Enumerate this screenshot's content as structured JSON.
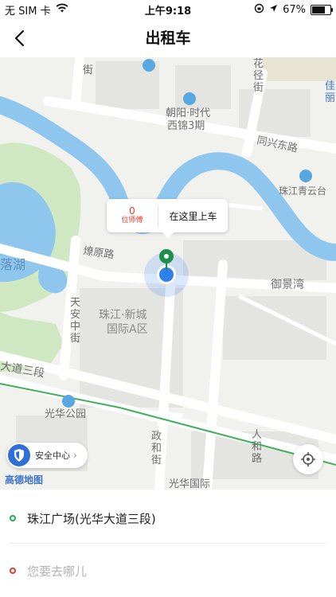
{
  "status_bar": {
    "carrier": "无 SIM 卡",
    "time": "上午9:18",
    "battery_percent": "67%",
    "battery_level": 0.67
  },
  "header": {
    "title": "出租车"
  },
  "map": {
    "labels": {
      "jie": "街",
      "huaxiang_jie": "花\n径\n街",
      "zhaoyang_1": "朝阳·时代",
      "zhaoyang_2": "西锦3期",
      "tongxing": "同兴东路",
      "zhujiang_qingyun": "珠江青云台",
      "jia_li": "佳\n丽",
      "luohu": "落湖",
      "liaoyuan": "燎原路",
      "yujingwan": "御景湾",
      "tianan": "天\n安\n中\n街",
      "xincheng_1": "珠江·新城",
      "xincheng_2": "国际A区",
      "dadao": "大道三段",
      "guanghua_park": "光华公园",
      "zhenghe": "政\n和\n街",
      "renhe": "人\n和\n路",
      "guanghua_intl": "光华国际"
    }
  },
  "pickup_bubble": {
    "count": "0",
    "count_label": "位师傅",
    "action": "在这里上车"
  },
  "safety_center": {
    "label": "安全中心",
    "chevron": "›"
  },
  "map_brand": "高德地图",
  "trip": {
    "start": "珠江广场(光华大道三段)",
    "destination_placeholder": "您要去哪儿"
  },
  "colors": {
    "start_dot": "#1eb15a",
    "dest_dot": "#e03a3a",
    "accent_blue": "#2f80ed",
    "river": "#8ec6ee",
    "park": "#cfe8c2"
  }
}
